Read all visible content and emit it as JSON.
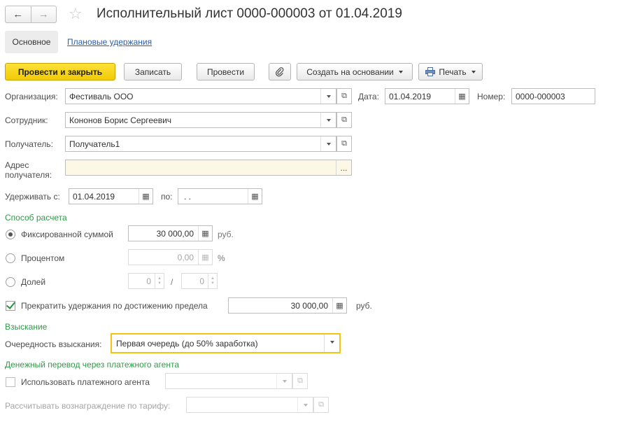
{
  "window": {
    "title": "Исполнительный лист 0000-000003 от 01.04.2019",
    "back_icon": "arrow-left-icon",
    "forward_icon": "arrow-right-icon",
    "favorite_icon": "star-icon"
  },
  "tabs": [
    {
      "label": "Основное"
    },
    {
      "label": "Плановые удержания"
    }
  ],
  "toolbar": {
    "post_close": "Провести и закрыть",
    "save": "Записать",
    "post": "Провести",
    "attach_icon": "paperclip-icon",
    "create_based": "Создать на основании",
    "print": "Печать",
    "print_icon": "printer-icon"
  },
  "form": {
    "org_label": "Организация:",
    "org_value": "Фестиваль ООО",
    "date_label": "Дата:",
    "date_value": "01.04.2019",
    "number_label": "Номер:",
    "number_value": "0000-000003",
    "employee_label": "Сотрудник:",
    "employee_value": "Кононов Борис Сергеевич",
    "recipient_label": "Получатель:",
    "recipient_value": "Получатель1",
    "address_label_line1": "Адрес",
    "address_label_line2": "получателя:",
    "address_value": "",
    "withhold_from_label": "Удерживать с:",
    "withhold_from_value": "01.04.2019",
    "to_label": "по:",
    "to_value": " .  .",
    "calc_section": "Способ расчета",
    "fixed_label": "Фиксированной суммой",
    "fixed_value": "30 000,00",
    "fixed_unit": "руб.",
    "percent_label": "Процентом",
    "percent_value": "0,00",
    "percent_unit": "%",
    "share_label": "Долей",
    "share_num": "0",
    "share_sep": "/",
    "share_den": "0",
    "stop_label": "Прекратить удержания по достижению предела",
    "stop_value": "30 000,00",
    "stop_unit": "руб.",
    "recovery_section": "Взыскание",
    "priority_label": "Очередность взыскания:",
    "priority_value": "Первая очередь (до 50% заработка)",
    "transfer_section": "Денежный перевод через платежного агента",
    "use_agent_label": "Использовать платежного агента",
    "fee_label": "Рассчитывать вознаграждение по тарифу:"
  }
}
